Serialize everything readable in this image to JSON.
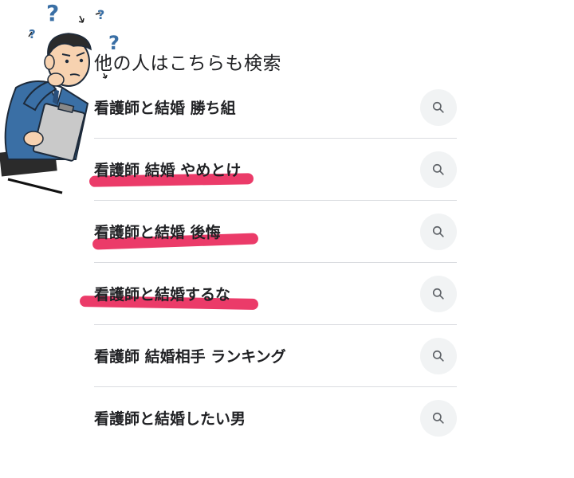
{
  "heading": "他の人はこちらも検索",
  "items": [
    {
      "label": "看護師と結婚 勝ち組",
      "icon": "search-icon",
      "highlighted": false
    },
    {
      "label": "看護師 結婚 やめとけ",
      "icon": "search-icon",
      "highlighted": true
    },
    {
      "label": "看護師と結婚 後悔",
      "icon": "search-icon",
      "highlighted": true
    },
    {
      "label": "看護師と結婚するな",
      "icon": "search-icon",
      "highlighted": true
    },
    {
      "label": "看護師 結婚相手 ランキング",
      "icon": "search-icon",
      "highlighted": false
    },
    {
      "label": "看護師と結婚したい男",
      "icon": "search-icon",
      "highlighted": false
    }
  ],
  "colors": {
    "highlight": "#e8194f",
    "text": "#202124",
    "divider": "#dadce0",
    "icon_bg": "#f1f3f4",
    "suit": "#3a6fa5",
    "question_marks": "#3a6fa5"
  },
  "illustration": {
    "subject": "confused-man-with-clipboard",
    "question_mark": "?"
  }
}
